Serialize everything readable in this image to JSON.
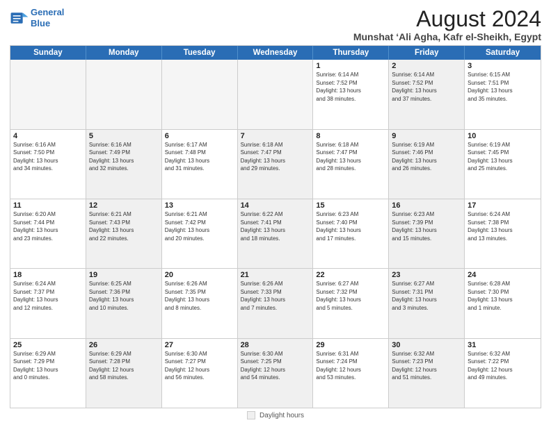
{
  "logo": {
    "line1": "General",
    "line2": "Blue"
  },
  "title": "August 2024",
  "subtitle": "Munshat ‘Ali Agha, Kafr el-Sheikh, Egypt",
  "weekdays": [
    "Sunday",
    "Monday",
    "Tuesday",
    "Wednesday",
    "Thursday",
    "Friday",
    "Saturday"
  ],
  "weeks": [
    [
      {
        "day": "",
        "info": "",
        "empty": true
      },
      {
        "day": "",
        "info": "",
        "empty": true
      },
      {
        "day": "",
        "info": "",
        "empty": true
      },
      {
        "day": "",
        "info": "",
        "empty": true
      },
      {
        "day": "1",
        "info": "Sunrise: 6:14 AM\nSunset: 7:52 PM\nDaylight: 13 hours\nand 38 minutes.",
        "shaded": false
      },
      {
        "day": "2",
        "info": "Sunrise: 6:14 AM\nSunset: 7:52 PM\nDaylight: 13 hours\nand 37 minutes.",
        "shaded": true
      },
      {
        "day": "3",
        "info": "Sunrise: 6:15 AM\nSunset: 7:51 PM\nDaylight: 13 hours\nand 35 minutes.",
        "shaded": false
      }
    ],
    [
      {
        "day": "4",
        "info": "Sunrise: 6:16 AM\nSunset: 7:50 PM\nDaylight: 13 hours\nand 34 minutes.",
        "shaded": false
      },
      {
        "day": "5",
        "info": "Sunrise: 6:16 AM\nSunset: 7:49 PM\nDaylight: 13 hours\nand 32 minutes.",
        "shaded": true
      },
      {
        "day": "6",
        "info": "Sunrise: 6:17 AM\nSunset: 7:48 PM\nDaylight: 13 hours\nand 31 minutes.",
        "shaded": false
      },
      {
        "day": "7",
        "info": "Sunrise: 6:18 AM\nSunset: 7:47 PM\nDaylight: 13 hours\nand 29 minutes.",
        "shaded": true
      },
      {
        "day": "8",
        "info": "Sunrise: 6:18 AM\nSunset: 7:47 PM\nDaylight: 13 hours\nand 28 minutes.",
        "shaded": false
      },
      {
        "day": "9",
        "info": "Sunrise: 6:19 AM\nSunset: 7:46 PM\nDaylight: 13 hours\nand 26 minutes.",
        "shaded": true
      },
      {
        "day": "10",
        "info": "Sunrise: 6:19 AM\nSunset: 7:45 PM\nDaylight: 13 hours\nand 25 minutes.",
        "shaded": false
      }
    ],
    [
      {
        "day": "11",
        "info": "Sunrise: 6:20 AM\nSunset: 7:44 PM\nDaylight: 13 hours\nand 23 minutes.",
        "shaded": false
      },
      {
        "day": "12",
        "info": "Sunrise: 6:21 AM\nSunset: 7:43 PM\nDaylight: 13 hours\nand 22 minutes.",
        "shaded": true
      },
      {
        "day": "13",
        "info": "Sunrise: 6:21 AM\nSunset: 7:42 PM\nDaylight: 13 hours\nand 20 minutes.",
        "shaded": false
      },
      {
        "day": "14",
        "info": "Sunrise: 6:22 AM\nSunset: 7:41 PM\nDaylight: 13 hours\nand 18 minutes.",
        "shaded": true
      },
      {
        "day": "15",
        "info": "Sunrise: 6:23 AM\nSunset: 7:40 PM\nDaylight: 13 hours\nand 17 minutes.",
        "shaded": false
      },
      {
        "day": "16",
        "info": "Sunrise: 6:23 AM\nSunset: 7:39 PM\nDaylight: 13 hours\nand 15 minutes.",
        "shaded": true
      },
      {
        "day": "17",
        "info": "Sunrise: 6:24 AM\nSunset: 7:38 PM\nDaylight: 13 hours\nand 13 minutes.",
        "shaded": false
      }
    ],
    [
      {
        "day": "18",
        "info": "Sunrise: 6:24 AM\nSunset: 7:37 PM\nDaylight: 13 hours\nand 12 minutes.",
        "shaded": false
      },
      {
        "day": "19",
        "info": "Sunrise: 6:25 AM\nSunset: 7:36 PM\nDaylight: 13 hours\nand 10 minutes.",
        "shaded": true
      },
      {
        "day": "20",
        "info": "Sunrise: 6:26 AM\nSunset: 7:35 PM\nDaylight: 13 hours\nand 8 minutes.",
        "shaded": false
      },
      {
        "day": "21",
        "info": "Sunrise: 6:26 AM\nSunset: 7:33 PM\nDaylight: 13 hours\nand 7 minutes.",
        "shaded": true
      },
      {
        "day": "22",
        "info": "Sunrise: 6:27 AM\nSunset: 7:32 PM\nDaylight: 13 hours\nand 5 minutes.",
        "shaded": false
      },
      {
        "day": "23",
        "info": "Sunrise: 6:27 AM\nSunset: 7:31 PM\nDaylight: 13 hours\nand 3 minutes.",
        "shaded": true
      },
      {
        "day": "24",
        "info": "Sunrise: 6:28 AM\nSunset: 7:30 PM\nDaylight: 13 hours\nand 1 minute.",
        "shaded": false
      }
    ],
    [
      {
        "day": "25",
        "info": "Sunrise: 6:29 AM\nSunset: 7:29 PM\nDaylight: 13 hours\nand 0 minutes.",
        "shaded": false
      },
      {
        "day": "26",
        "info": "Sunrise: 6:29 AM\nSunset: 7:28 PM\nDaylight: 12 hours\nand 58 minutes.",
        "shaded": true
      },
      {
        "day": "27",
        "info": "Sunrise: 6:30 AM\nSunset: 7:27 PM\nDaylight: 12 hours\nand 56 minutes.",
        "shaded": false
      },
      {
        "day": "28",
        "info": "Sunrise: 6:30 AM\nSunset: 7:25 PM\nDaylight: 12 hours\nand 54 minutes.",
        "shaded": true
      },
      {
        "day": "29",
        "info": "Sunrise: 6:31 AM\nSunset: 7:24 PM\nDaylight: 12 hours\nand 53 minutes.",
        "shaded": false
      },
      {
        "day": "30",
        "info": "Sunrise: 6:32 AM\nSunset: 7:23 PM\nDaylight: 12 hours\nand 51 minutes.",
        "shaded": true
      },
      {
        "day": "31",
        "info": "Sunrise: 6:32 AM\nSunset: 7:22 PM\nDaylight: 12 hours\nand 49 minutes.",
        "shaded": false
      }
    ]
  ],
  "footer": {
    "box_label": "Daylight hours"
  }
}
